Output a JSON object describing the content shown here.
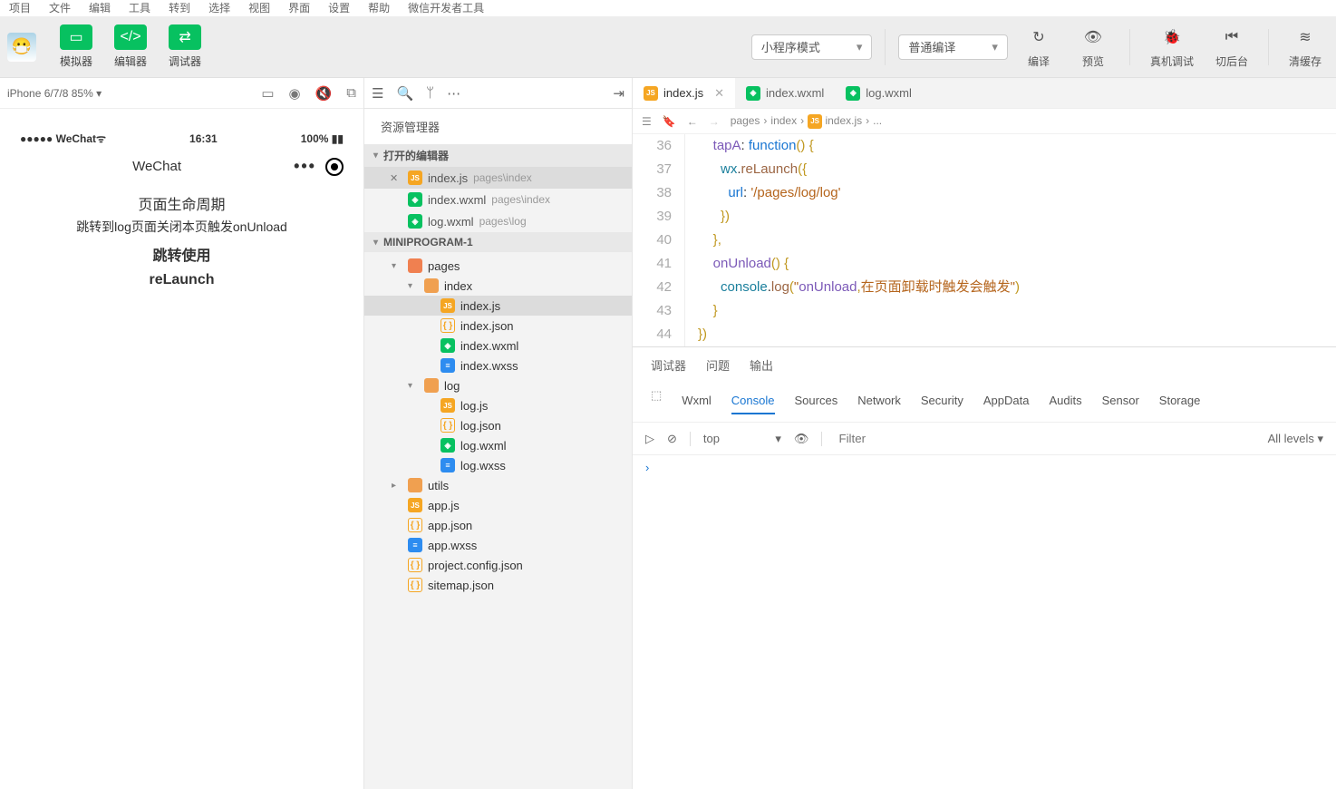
{
  "topmenu": [
    "项目",
    "文件",
    "编辑",
    "工具",
    "转到",
    "选择",
    "视图",
    "界面",
    "设置",
    "帮助",
    "微信开发者工具"
  ],
  "toolbar": {
    "simulator": "模拟器",
    "editor": "编辑器",
    "debugger": "调试器",
    "mode": "小程序模式",
    "compile_mode": "普通编译",
    "compile": "编译",
    "preview": "预览",
    "real": "真机调试",
    "back": "切后台",
    "cache": "清缓存"
  },
  "simulator": {
    "device": "iPhone 6/7/8 85%",
    "signal": "●●●●●",
    "carrier": "WeChat",
    "wifi": "ᯤ",
    "time": "16:31",
    "battery": "100%",
    "title": "WeChat",
    "page_title": "页面生命周期",
    "page_sub": "跳转到log页面关闭本页触发onUnload",
    "btn1": "跳转使用",
    "btn2": "reLaunch"
  },
  "explorer": {
    "title": "资源管理器",
    "open_editors": "打开的编辑器",
    "open_files": [
      {
        "name": "index.js",
        "path": "pages\\index",
        "active": true,
        "icon": "js"
      },
      {
        "name": "index.wxml",
        "path": "pages\\index",
        "icon": "wxml"
      },
      {
        "name": "log.wxml",
        "path": "pages\\log",
        "icon": "wxml"
      }
    ],
    "project": "MINIPROGRAM-1",
    "tree": [
      {
        "d": 1,
        "caret": "t",
        "icon": "folder-o",
        "name": "pages"
      },
      {
        "d": 2,
        "caret": "t",
        "icon": "folder",
        "name": "index"
      },
      {
        "d": 3,
        "caret": "n",
        "icon": "js",
        "name": "index.js",
        "sel": true
      },
      {
        "d": 3,
        "caret": "n",
        "icon": "json",
        "name": "index.json"
      },
      {
        "d": 3,
        "caret": "n",
        "icon": "wxml",
        "name": "index.wxml"
      },
      {
        "d": 3,
        "caret": "n",
        "icon": "wxss",
        "name": "index.wxss"
      },
      {
        "d": 2,
        "caret": "t",
        "icon": "folder",
        "name": "log"
      },
      {
        "d": 3,
        "caret": "n",
        "icon": "js",
        "name": "log.js"
      },
      {
        "d": 3,
        "caret": "n",
        "icon": "json",
        "name": "log.json"
      },
      {
        "d": 3,
        "caret": "n",
        "icon": "wxml",
        "name": "log.wxml"
      },
      {
        "d": 3,
        "caret": "n",
        "icon": "wxss",
        "name": "log.wxss"
      },
      {
        "d": 1,
        "caret": "r",
        "icon": "folder",
        "name": "utils"
      },
      {
        "d": 1,
        "caret": "n",
        "icon": "js",
        "name": "app.js"
      },
      {
        "d": 1,
        "caret": "n",
        "icon": "json",
        "name": "app.json"
      },
      {
        "d": 1,
        "caret": "n",
        "icon": "wxss",
        "name": "app.wxss"
      },
      {
        "d": 1,
        "caret": "n",
        "icon": "json",
        "name": "project.config.json"
      },
      {
        "d": 1,
        "caret": "n",
        "icon": "json",
        "name": "sitemap.json"
      }
    ]
  },
  "editor": {
    "tabs": [
      {
        "name": "index.js",
        "icon": "js",
        "active": true,
        "close": true
      },
      {
        "name": "index.wxml",
        "icon": "wxml"
      },
      {
        "name": "log.wxml",
        "icon": "wxml"
      }
    ],
    "breadcrumb": [
      "pages",
      "index",
      "index.js",
      "..."
    ],
    "lines": [
      "36",
      "37",
      "38",
      "39",
      "40",
      "41",
      "42",
      "43",
      "44"
    ],
    "code": {
      "l36": "    tapA: function() {",
      "l37": "      wx.reLaunch({",
      "l38": "        url: '/pages/log/log'",
      "l39": "      })",
      "l40": "    },",
      "l41": "    onUnload() {",
      "l42": "      console.log(\"onUnload,在页面卸载时触发会触发\")",
      "l43": "    }",
      "l44": "})"
    }
  },
  "panel": {
    "tabs": [
      "调试器",
      "问题",
      "输出"
    ],
    "devtools": [
      "Wxml",
      "Console",
      "Sources",
      "Network",
      "Security",
      "AppData",
      "Audits",
      "Sensor",
      "Storage"
    ],
    "context": "top",
    "filter_ph": "Filter",
    "levels": "All levels",
    "prompt": "›"
  }
}
